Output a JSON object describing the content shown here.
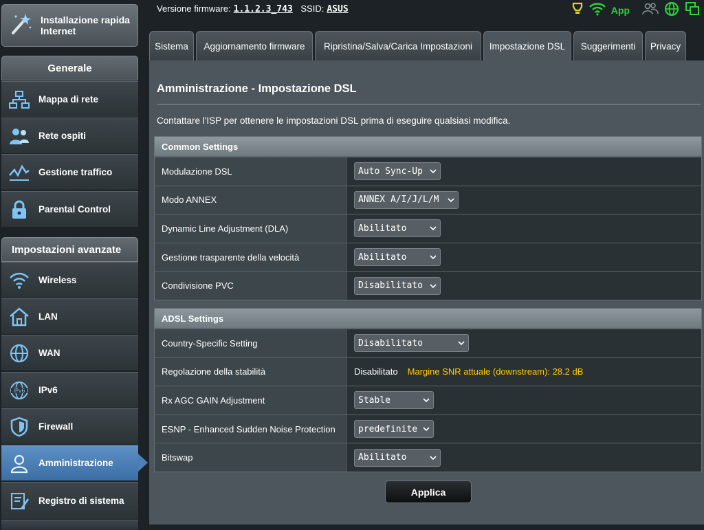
{
  "sidebar": {
    "quick_setup": "Installazione rapida Internet",
    "general_header": "Generale",
    "general_items": [
      {
        "label": "Mappa di rete",
        "icon": "network-map-icon"
      },
      {
        "label": "Rete ospiti",
        "icon": "guest-network-icon"
      },
      {
        "label": "Gestione traffico",
        "icon": "traffic-manager-icon"
      },
      {
        "label": "Parental Control",
        "icon": "lock-icon"
      }
    ],
    "advanced_header": "Impostazioni avanzate",
    "advanced_items": [
      {
        "label": "Wireless",
        "icon": "wifi-icon"
      },
      {
        "label": "LAN",
        "icon": "home-icon"
      },
      {
        "label": "WAN",
        "icon": "globe-icon"
      },
      {
        "label": "IPv6",
        "icon": "ipv6-icon"
      },
      {
        "label": "Firewall",
        "icon": "shield-icon"
      },
      {
        "label": "Amministrazione",
        "icon": "admin-user-icon",
        "active": true
      },
      {
        "label": "Registro di sistema",
        "icon": "system-log-icon"
      }
    ]
  },
  "topbar": {
    "firmware_label": "Versione firmware:",
    "firmware_value": "1.1.2.3_743",
    "ssid_label": "SSID:",
    "ssid_value": "ASUS",
    "app_label": "App"
  },
  "tabs": [
    {
      "label": "Sistema"
    },
    {
      "label": "Aggiornamento firmware"
    },
    {
      "label": "Ripristina/Salva/Carica Impostazioni"
    },
    {
      "label": "Impostazione DSL",
      "active": true
    },
    {
      "label": "Suggerimenti"
    },
    {
      "label": "Privacy"
    }
  ],
  "page": {
    "title": "Amministrazione - Impostazione DSL",
    "description": "Contattare l'ISP per ottenere le impostazioni DSL prima di eseguire qualsiasi modifica.",
    "apply_label": "Applica"
  },
  "common_settings": {
    "header": "Common Settings",
    "rows": [
      {
        "label": "Modulazione DSL",
        "value": "Auto Sync-Up"
      },
      {
        "label": "Modo ANNEX",
        "value": "ANNEX A/I/J/L/M"
      },
      {
        "label": "Dynamic Line Adjustment (DLA)",
        "value": "Abilitato"
      },
      {
        "label": "Gestione trasparente della velocità",
        "value": "Abilitato"
      },
      {
        "label": "Condivisione PVC",
        "value": "Disabilitato"
      }
    ]
  },
  "adsl_settings": {
    "header": "ADSL Settings",
    "rows": [
      {
        "label": "Country-Specific Setting",
        "value": "Disabilitato"
      },
      {
        "label": "Regolazione della stabilità",
        "value": "Disabilitato",
        "note": "Margine SNR attuale (downstream): 28.2 dB"
      },
      {
        "label": "Rx AGC GAIN Adjustment",
        "value": "Stable"
      },
      {
        "label": "ESNP - Enhanced Sudden Noise Protection",
        "value": "predefinite"
      },
      {
        "label": "Bitswap",
        "value": "Abilitato"
      }
    ]
  },
  "colors": {
    "accent_active": "#4c80b6",
    "snr_note": "#ffcc00",
    "app_green": "#2fd03b"
  }
}
